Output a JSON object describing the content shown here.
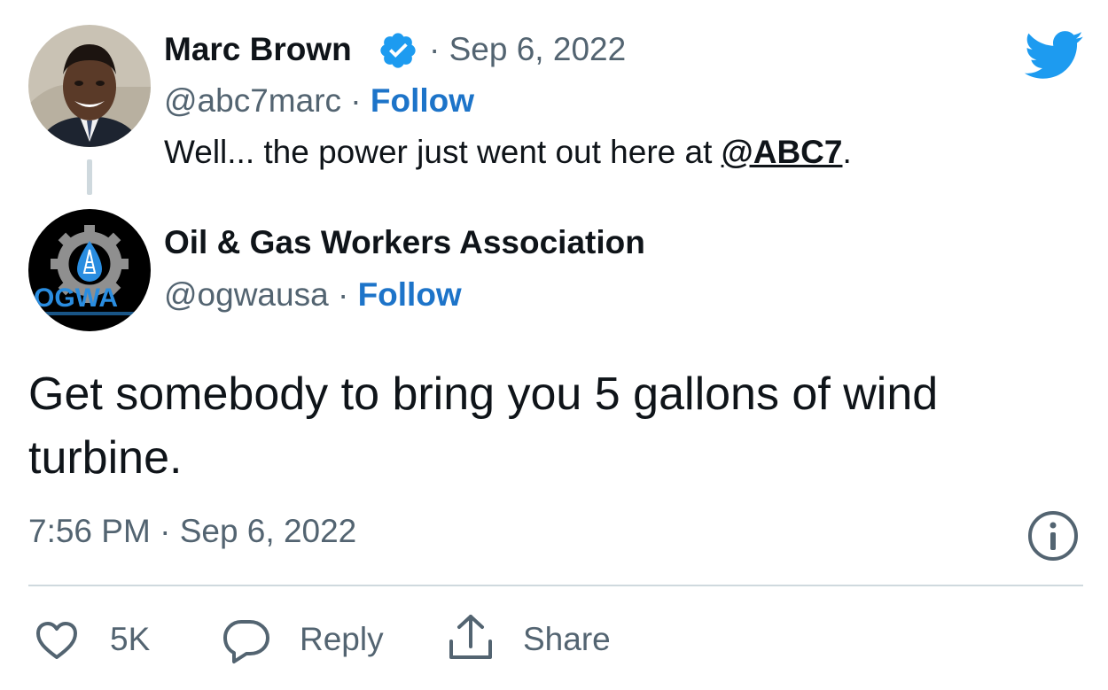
{
  "reply_to": {
    "author_name": "Marc Brown",
    "verified": true,
    "separator": "·",
    "date": "Sep 6, 2022",
    "handle": "@abc7marc",
    "follow_label": "Follow",
    "text_prefix": "Well... the power just went out here at ",
    "mention": "@ABC7",
    "text_suffix": "."
  },
  "tweet": {
    "author_name": "Oil & Gas Workers Association",
    "handle": "@ogwausa",
    "follow_label": "Follow",
    "avatar_logo_text": "OGWA",
    "text": "Get somebody to bring you 5 gallons of wind turbine.",
    "time": "7:56 PM",
    "date": "Sep 6, 2022"
  },
  "actions": {
    "likes_count": "5K",
    "reply_label": "Reply",
    "share_label": "Share"
  },
  "icons": {
    "brand": "twitter-bird-icon",
    "verified": "verified-badge-icon",
    "info": "info-icon",
    "like": "heart-icon",
    "reply": "reply-bubble-icon",
    "share": "share-icon"
  },
  "colors": {
    "brand_blue": "#1d9bf0",
    "follow_blue": "#1d74c9",
    "text_primary": "#0f1419",
    "text_secondary": "#536471"
  }
}
